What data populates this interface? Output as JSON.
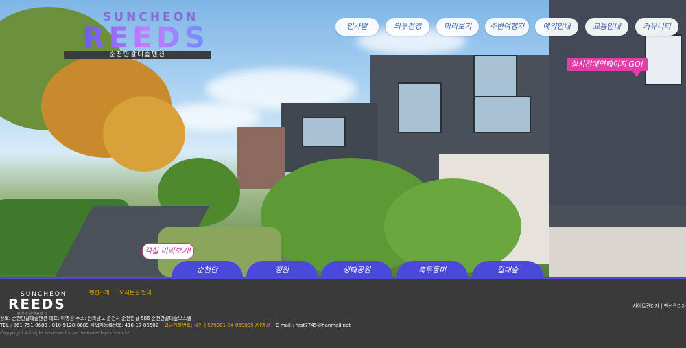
{
  "logo": {
    "sub": "SUNCHEON",
    "main": "REEDS",
    "tagline": "순천만갈대숲펜션"
  },
  "nav": [
    {
      "label": "인사말"
    },
    {
      "label": "외부전경"
    },
    {
      "label": "미리보기"
    },
    {
      "label": "주변여행지"
    },
    {
      "label": "예약안내"
    },
    {
      "label": "교통안내"
    },
    {
      "label": "커뮤니티"
    }
  ],
  "realtime_badge": "실시간예약페이지 GO!",
  "room_preview_bubble": "객실 미리보기!",
  "tabs": [
    {
      "label": "순천만"
    },
    {
      "label": "정원"
    },
    {
      "label": "생태공원"
    },
    {
      "label": "축두동미"
    },
    {
      "label": "갈대숲"
    }
  ],
  "footer": {
    "logo_sub": "SUNCHEON",
    "logo_main": "REEDS",
    "logo_tag": "순천만갈대숲펜션",
    "links": [
      "펜션소개",
      "오시는길 안내"
    ],
    "admin": "사이트관리자 | 펜션관리자",
    "line1": "상호: 순천만갈대숲펜션   대표: 이영광   주소: 전라남도 순천시 순천만길 586 순천만갈대숲모스텔",
    "line2": "TEL : 061-751-0689 , 010-9128-0689   사업자등록번호: 416-17-86502",
    "account_label": "입금계좌번호: 국민 | 579301-04-059095 /이영광",
    "email": "E-mail : first7745@hanmail.net",
    "copyright": "Copyright All right reserved suncheonreedspension.kr"
  }
}
